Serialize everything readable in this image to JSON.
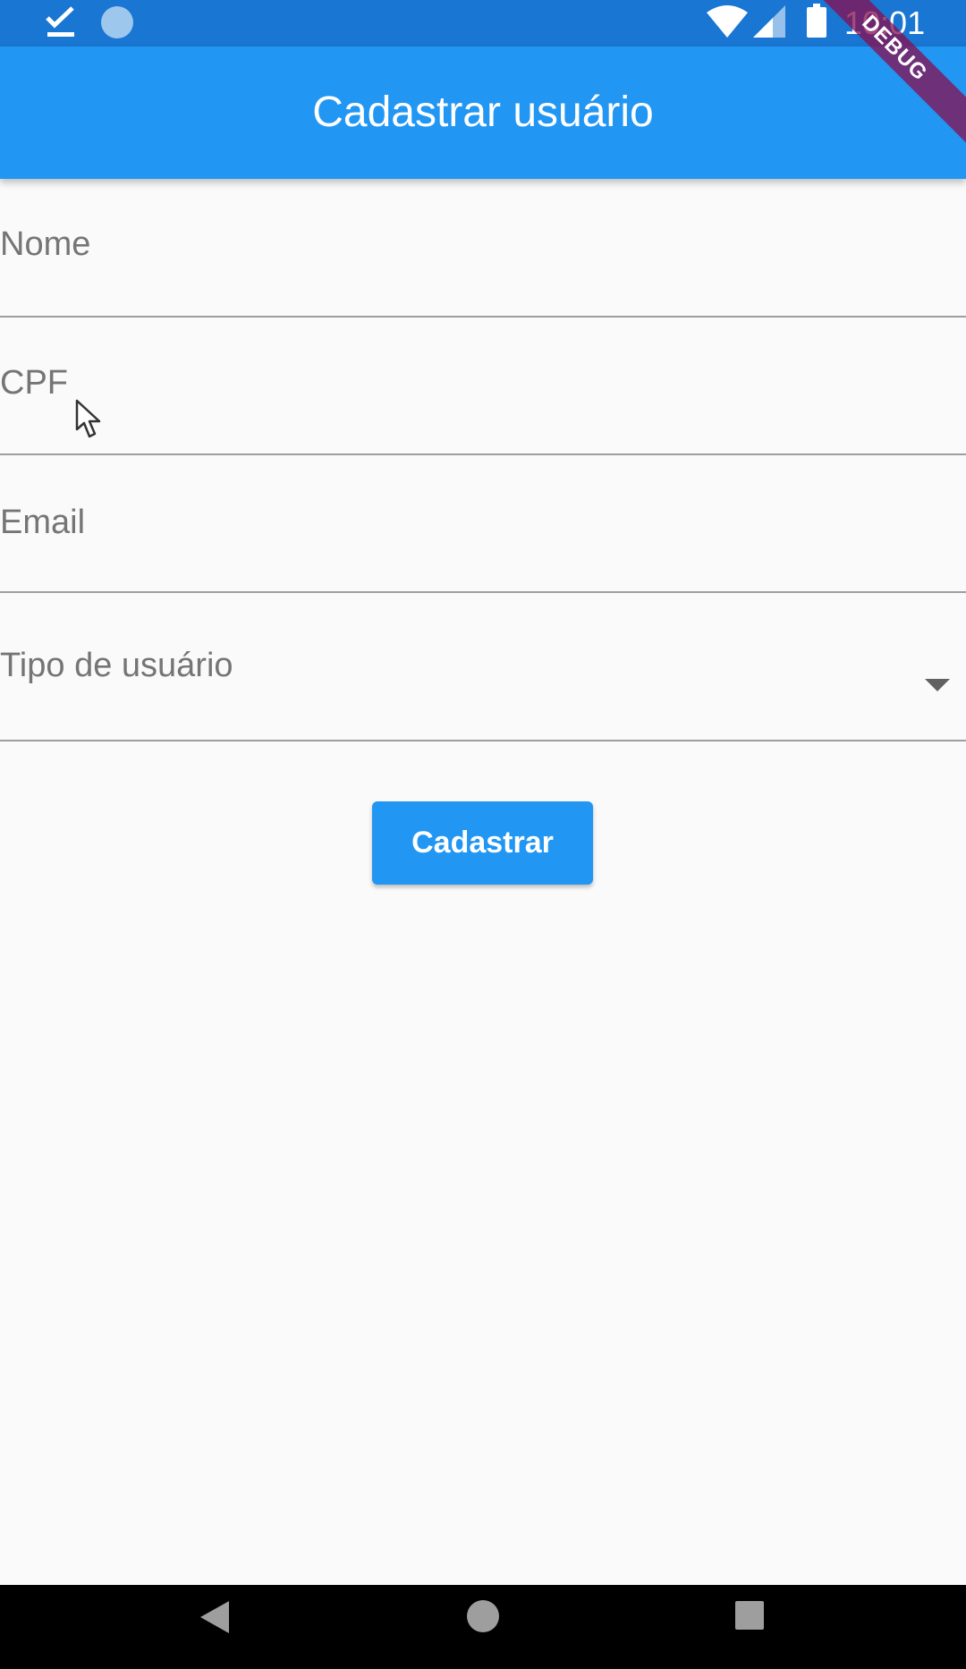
{
  "status_bar": {
    "time": "10:01",
    "icons": [
      "check-icon",
      "circle-icon",
      "wifi-icon",
      "signal-icon",
      "battery-icon"
    ]
  },
  "debug_banner": "DEBUG",
  "app_bar": {
    "title": "Cadastrar usuário"
  },
  "form": {
    "name_label": "Nome",
    "cpf_label": "CPF",
    "email_label": "Email",
    "user_type_label": "Tipo de usuário",
    "submit_label": "Cadastrar"
  },
  "colors": {
    "primary": "#2196F3",
    "status_bar": "#1976D2",
    "background": "#FAFAFA",
    "label": "#757575"
  }
}
